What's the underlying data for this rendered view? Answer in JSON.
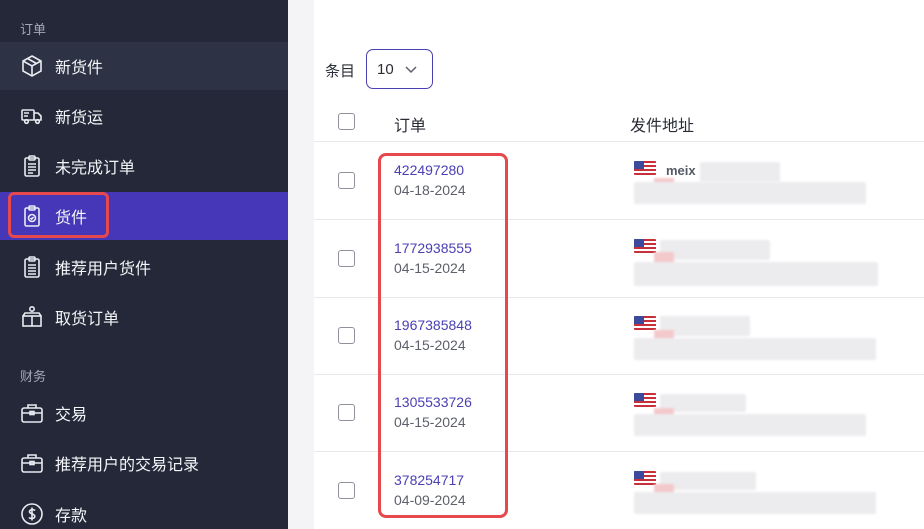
{
  "sidebar": {
    "section_orders": "订单",
    "section_finance": "财务",
    "items": [
      {
        "label": "新货件",
        "icon": "package-icon"
      },
      {
        "label": "新货运",
        "icon": "truck-icon"
      },
      {
        "label": "未完成订单",
        "icon": "clipboard-list-icon"
      },
      {
        "label": "货件",
        "icon": "clipboard-check-icon"
      },
      {
        "label": "推荐用户货件",
        "icon": "clipboard-referral-icon"
      },
      {
        "label": "取货订单",
        "icon": "pickup-box-icon"
      },
      {
        "label": "交易",
        "icon": "wallet-icon"
      },
      {
        "label": "推荐用户的交易记录",
        "icon": "wallet-referral-icon"
      },
      {
        "label": "存款",
        "icon": "dollar-circle-icon"
      }
    ],
    "active_item": "货件"
  },
  "toolbar": {
    "entries_label": "条目",
    "entries_value": "10"
  },
  "table": {
    "columns": [
      "订单",
      "发件地址"
    ],
    "rows": [
      {
        "order_id": "422497280",
        "date": "04-18-2024",
        "address_text": "meix"
      },
      {
        "order_id": "1772938555",
        "date": "04-15-2024",
        "address_text": ""
      },
      {
        "order_id": "1967385848",
        "date": "04-15-2024",
        "address_text": ""
      },
      {
        "order_id": "1305533726",
        "date": "04-15-2024",
        "address_text": ""
      },
      {
        "order_id": "378254717",
        "date": "04-09-2024",
        "address_text": ""
      }
    ]
  },
  "colors": {
    "sidebar_bg": "#242838",
    "active_bg": "#4636b8",
    "accent": "#4a3fb3",
    "highlight": "#e5484d"
  }
}
